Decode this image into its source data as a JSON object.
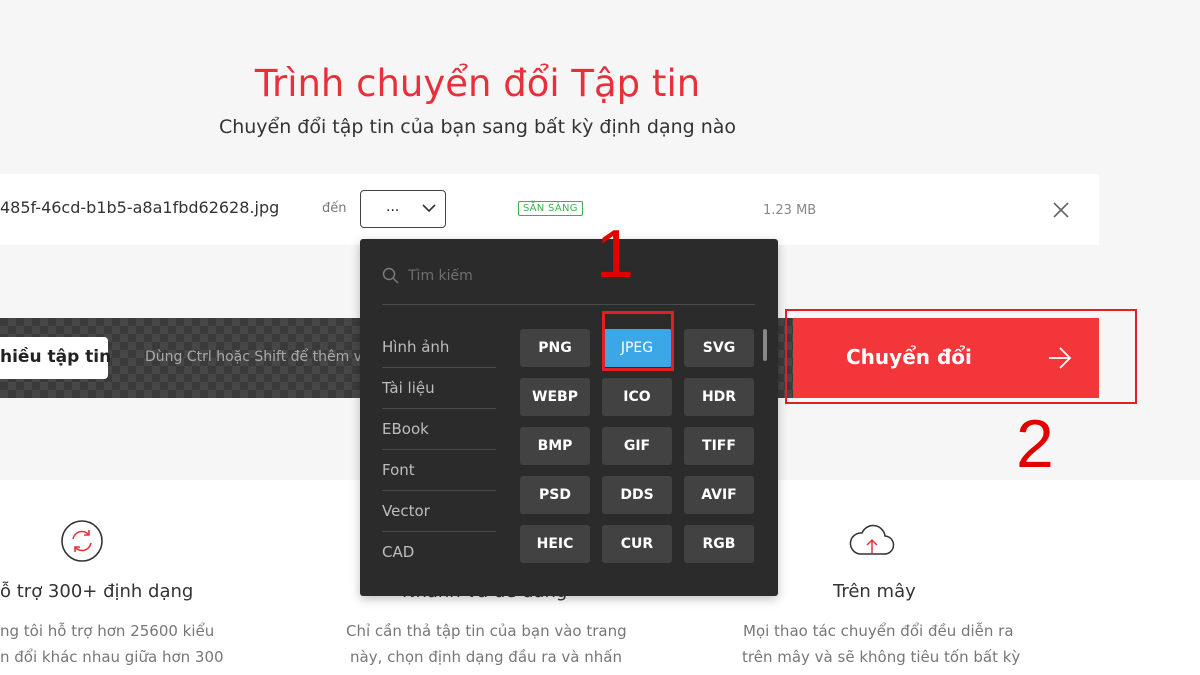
{
  "header": {
    "title": "Trình chuyển đổi Tập tin",
    "subtitle": "Chuyển đổi tập tin của bạn sang bất kỳ định dạng nào"
  },
  "file": {
    "name": "485f-46cd-b1b5-a8a1fbd62628.jpg",
    "to_label": "đến",
    "format_value": "...",
    "status": "SẴN SÀNG",
    "size": "1.23 MB"
  },
  "actions": {
    "add_files_label": "hiều tập tin",
    "hint": "Dùng Ctrl hoặc Shift để thêm vài",
    "convert_label": "Chuyển đổi"
  },
  "dropdown": {
    "search_placeholder": "Tìm kiếm",
    "categories": [
      "Hình ảnh",
      "Tài liệu",
      "EBook",
      "Font",
      "Vector",
      "CAD"
    ],
    "formats": [
      "PNG",
      "JPEG",
      "SVG",
      "WEBP",
      "ICO",
      "HDR",
      "BMP",
      "GIF",
      "TIFF",
      "PSD",
      "DDS",
      "AVIF",
      "HEIC",
      "CUR",
      "RGB"
    ],
    "selected": "JPEG"
  },
  "annotations": {
    "step1": "1",
    "step2": "2"
  },
  "features": [
    {
      "title": "ỗ trợ 300+ định dạng",
      "desc1": "ng tôi hỗ trợ hơn 25600 kiểu",
      "desc2": "n đổi khác nhau giữa hơn 300",
      "icon": "refresh-icon"
    },
    {
      "title": "Nhanh và dễ dàng",
      "desc1": "Chỉ cần thả tập tin của bạn vào trang",
      "desc2": "này, chọn định dạng đầu ra và nhấn",
      "icon": "lightning-icon"
    },
    {
      "title": "Trên mây",
      "desc1": "Mọi thao tác chuyển đổi đều diễn ra",
      "desc2": "trên mây và sẽ không tiêu tốn bất kỳ",
      "icon": "cloud-upload-icon"
    }
  ],
  "colors": {
    "accent_red": "#f3363a",
    "title_red": "#e8303a",
    "selected_blue": "#3ca7e6",
    "status_green": "#37b24d",
    "dropdown_bg": "#2b2b2b"
  }
}
